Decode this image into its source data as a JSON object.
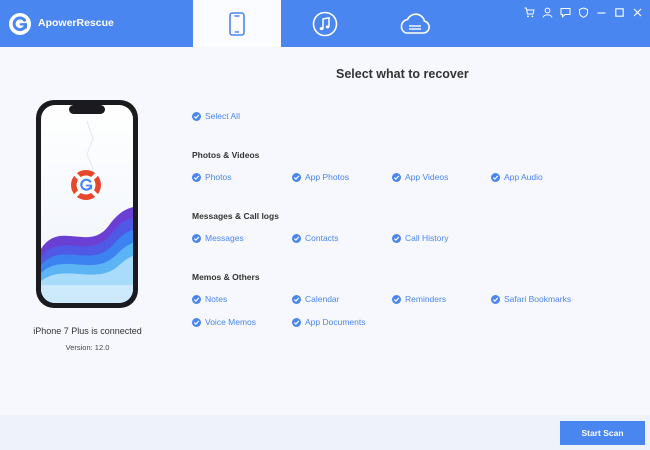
{
  "app": {
    "name": "ApowerRescue"
  },
  "colors": {
    "accent": "#4a86f0",
    "background": "#f6f8fd"
  },
  "tabs": [
    {
      "icon": "phone-icon",
      "active": true
    },
    {
      "icon": "music-icon",
      "active": false
    },
    {
      "icon": "cloud-icon",
      "active": false
    }
  ],
  "window_controls": [
    "cart-icon",
    "user-icon",
    "feedback-icon",
    "shield-icon",
    "minimize-icon",
    "maximize-icon",
    "close-icon"
  ],
  "heading": "Select what to recover",
  "device": {
    "caption": "iPhone 7 Plus is connected",
    "version": "Version: 12.0"
  },
  "select_all": "Select All",
  "sections": {
    "photos": {
      "title": "Photos & Videos",
      "items": [
        "Photos",
        "App Photos",
        "App Videos",
        "App Audio"
      ]
    },
    "messages": {
      "title": "Messages & Call logs",
      "items": [
        "Messages",
        "Contacts",
        "Call History"
      ]
    },
    "memos": {
      "title": "Memos & Others",
      "items": [
        "Notes",
        "Calendar",
        "Reminders",
        "Safari Bookmarks",
        "Voice Memos",
        "App Documents"
      ]
    }
  },
  "start_button": "Start Scan"
}
